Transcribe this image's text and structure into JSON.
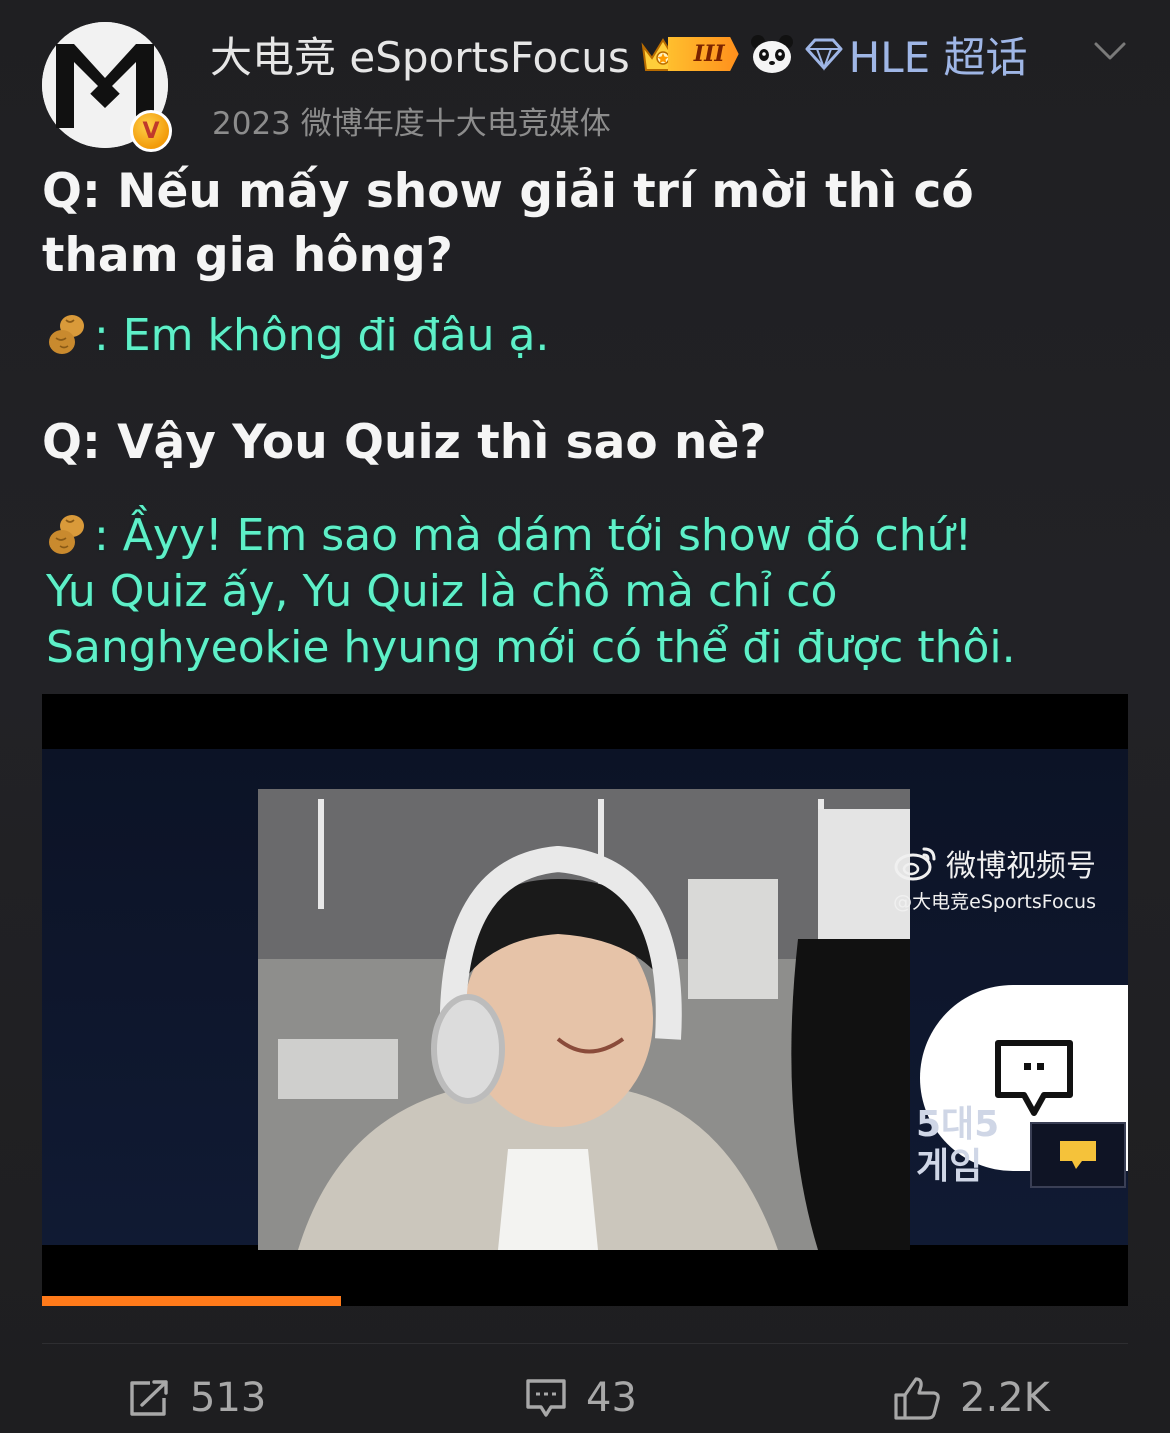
{
  "header": {
    "username": "大电竞 eSportsFocus",
    "level_badge": "III",
    "super_topic": "HLE 超话",
    "subtitle": "2023 微博年度十大电竞媒体",
    "verified_icon": "v-badge-icon"
  },
  "content": {
    "q1_line1": "Q: Nếu mấy show giải trí mời thì có",
    "q1_line2": "tham gia hông?",
    "a1": ": Em không đi đâu ạ.",
    "q2": "Q: Vậy You Quiz thì sao nè?",
    "a2_line1": ": Ầyy! Em sao mà dám tới show đó chứ!",
    "a2_line2": "Yu Quiz ấy, Yu Quiz là chỗ mà chỉ có",
    "a2_line3": "Sanghyeokie hyung mới có thể đi được thôi."
  },
  "video": {
    "watermark_title": "微博视频号",
    "watermark_handle": "@大电竞eSportsFocus",
    "overlay_line1": "5대5",
    "overlay_line2": "게임",
    "progress": 0.275
  },
  "actions": {
    "repost_count": "513",
    "comment_count": "43",
    "like_count": "2.2K"
  },
  "colors": {
    "answer_text": "#5ef0c8",
    "progress": "#ff7a1a",
    "super_topic": "#9fb6e6"
  }
}
